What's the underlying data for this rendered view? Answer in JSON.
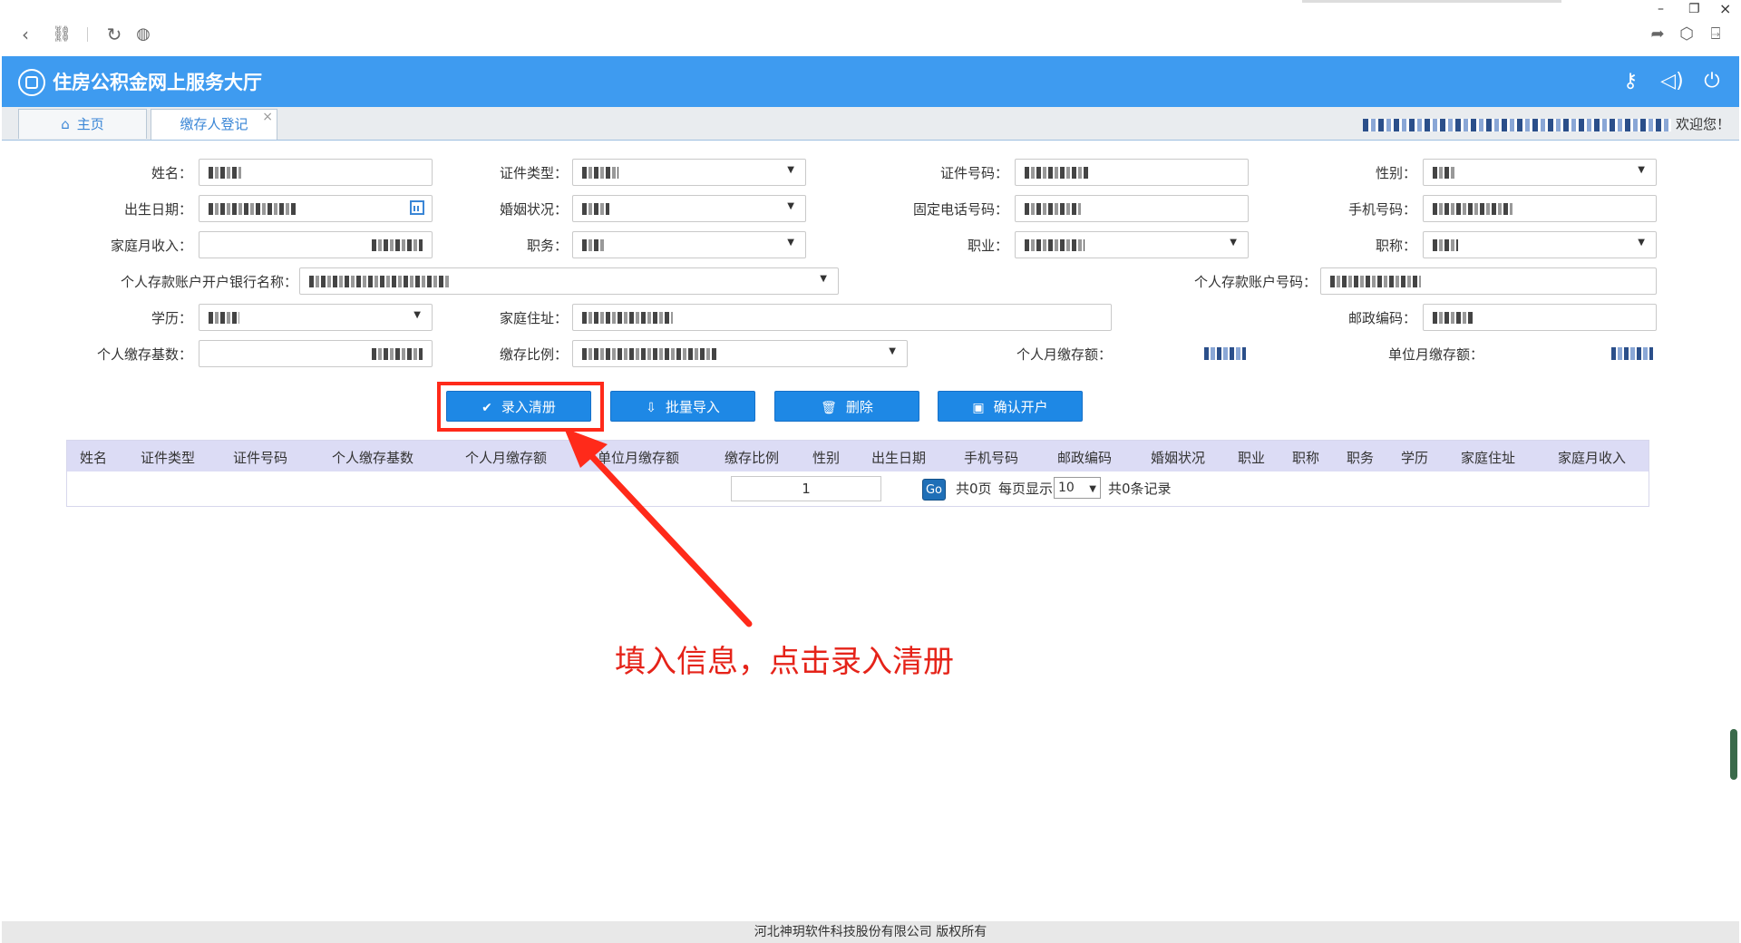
{
  "browser": {
    "win_min": "–",
    "win_restore": "❐",
    "win_close": "×"
  },
  "app": {
    "title": "住房公积金网上服务大厅"
  },
  "tabs": [
    {
      "label": "主页"
    },
    {
      "label": "缴存人登记",
      "close": "×"
    }
  ],
  "header": {
    "welcome": "欢迎您！"
  },
  "form": {
    "name_label": "姓名：",
    "id_type_label": "证件类型：",
    "id_no_label": "证件号码：",
    "gender_label": "性别：",
    "birth_label": "出生日期：",
    "marital_label": "婚姻状况：",
    "phone_label": "固定电话号码：",
    "mobile_label": "手机号码：",
    "income_label": "家庭月收入：",
    "duty_label": "职务：",
    "job_label": "职业：",
    "title_label": "职称：",
    "bank_label": "个人存款账户开户银行名称：",
    "account_label": "个人存款账户号码：",
    "edu_label": "学历：",
    "address_label": "家庭住址：",
    "postcode_label": "邮政编码：",
    "base_label": "个人缴存基数：",
    "ratio_label": "缴存比例：",
    "personal_amt_label": "个人月缴存额：",
    "unit_amt_label": "单位月缴存额："
  },
  "actions": {
    "enter": "录入清册",
    "batch_import": "批量导入",
    "delete": "删除",
    "confirm": "确认开户"
  },
  "table": {
    "columns": [
      "姓名",
      "证件类型",
      "证件号码",
      "个人缴存基数",
      "个人月缴存额",
      "单位月缴存额",
      "缴存比例",
      "性别",
      "出生日期",
      "手机号码",
      "邮政编码",
      "婚姻状况",
      "职业",
      "职称",
      "职务",
      "学历",
      "家庭住址",
      "家庭月收入"
    ]
  },
  "pager": {
    "page": "1",
    "go": "Go",
    "total_pages": "共0页",
    "per_page_label": "每页显示",
    "per_page": "10",
    "total_records": "共0条记录"
  },
  "annotation": {
    "text": "填入信息，点击录入清册",
    "color": "#e52319"
  },
  "footer": {
    "copyright": "河北神玥软件科技股份有限公司 版权所有"
  },
  "colors": {
    "header_bg": "#3e9bf0",
    "button_bg": "#1e88e5",
    "highlight": "#ff2a1a",
    "table_head_bg": "#dcdcf5"
  }
}
